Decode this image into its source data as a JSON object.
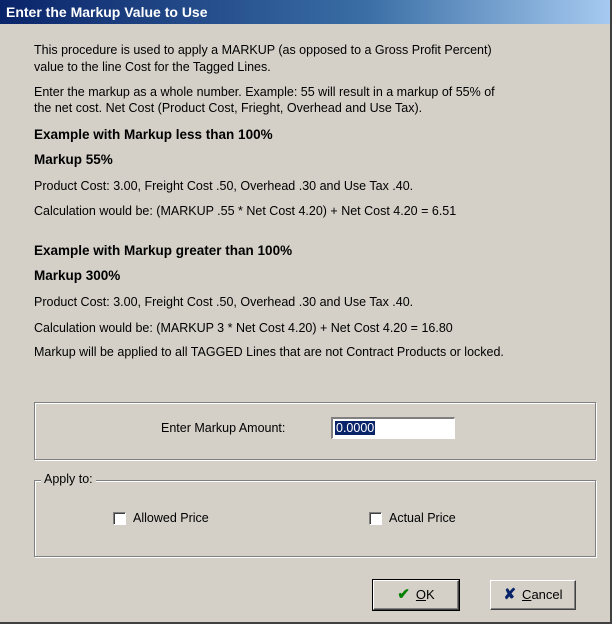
{
  "window": {
    "title": "Enter the Markup Value to Use"
  },
  "text": {
    "intro_1": "This procedure is used to apply a MARKUP (as opposed to a Gross Profit Percent)",
    "intro_2": "value to the line Cost for the Tagged Lines.",
    "instr_1": "Enter the markup as a whole number. Example: 55 will result in a markup of 55% of",
    "instr_2": "the net cost.  Net Cost (Product Cost, Frieght, Overhead and Use Tax).",
    "ex1_heading": "Example with Markup less than 100%",
    "ex1_markup": "Markup 55%",
    "ex1_costs": "Product Cost: 3.00, Freight Cost .50, Overhead .30 and Use Tax .40.",
    "ex1_calc": "Calculation would be: (MARKUP .55 * Net Cost 4.20) + Net Cost 4.20 = 6.51",
    "ex2_heading": "Example with Markup greater than 100%",
    "ex2_markup": "Markup 300%",
    "ex2_costs": "Product Cost: 3.00, Freight Cost .50, Overhead .30 and Use Tax .40.",
    "ex2_calc": "Calculation would be: (MARKUP  3 * Net Cost 4.20) + Net Cost 4.20 = 16.80",
    "note": "Markup will be applied to all TAGGED Lines that are not Contract Products or locked."
  },
  "markup_field": {
    "label": "Enter Markup Amount:",
    "value": "0.0000"
  },
  "apply_group": {
    "legend": "Apply to:",
    "allowed_label": "Allowed Price",
    "allowed_checked": false,
    "actual_label": "Actual Price",
    "actual_checked": false
  },
  "buttons": {
    "ok_hotkey": "O",
    "ok_rest": "K",
    "cancel_hotkey": "C",
    "cancel_rest": "ancel"
  },
  "colors": {
    "title_start": "#0a246a",
    "title_end": "#a6caf0",
    "face": "#d4d0c8",
    "ok_check": "#008000",
    "cancel_x": "#0a246a"
  },
  "icons": {
    "ok": "check-icon",
    "cancel": "x-icon"
  }
}
